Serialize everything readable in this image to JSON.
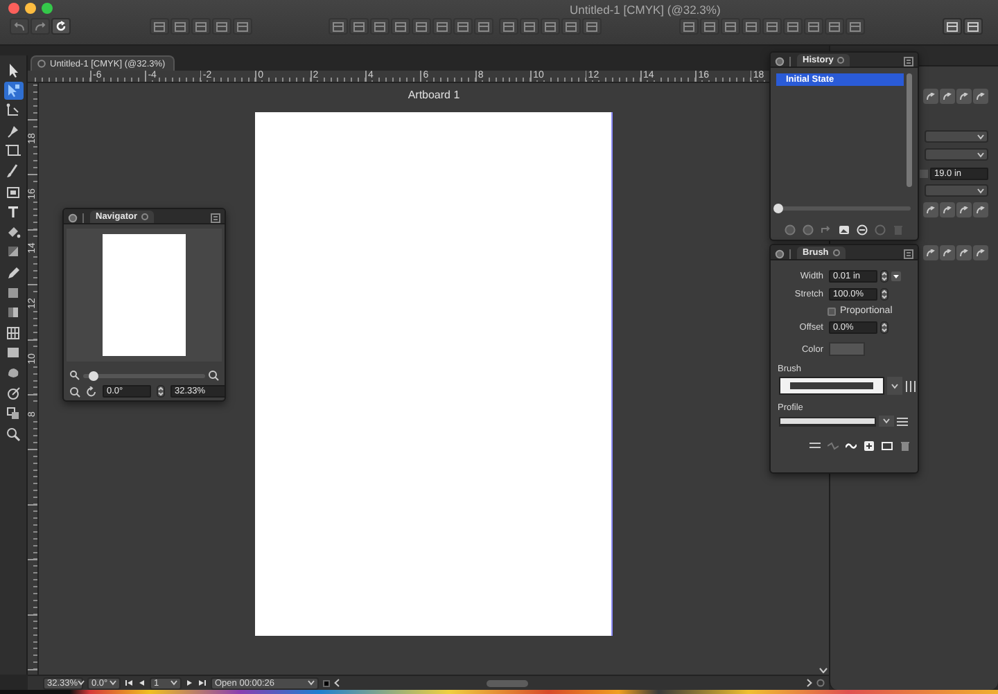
{
  "window": {
    "title": "Untitled-1 [CMYK] (@32.3%)"
  },
  "toolbar_groups": [
    [
      {
        "disabled": true
      },
      {
        "disabled": true
      },
      {
        "disabled": false
      }
    ],
    [
      {
        "disabled": true
      },
      {
        "disabled": true
      },
      {
        "disabled": true
      },
      {
        "disabled": true
      },
      {
        "disabled": true
      }
    ],
    [
      {
        "disabled": true
      },
      {
        "disabled": true
      },
      {
        "disabled": true
      },
      {
        "disabled": true
      },
      {
        "disabled": true
      },
      {
        "disabled": true
      },
      {
        "disabled": true
      },
      {
        "disabled": true
      }
    ],
    [
      {
        "disabled": true
      },
      {
        "disabled": true
      },
      {
        "disabled": true
      },
      {
        "disabled": true
      },
      {
        "disabled": true
      }
    ],
    [
      {
        "disabled": true
      },
      {
        "disabled": true
      },
      {
        "disabled": true
      },
      {
        "disabled": true
      },
      {
        "disabled": true
      },
      {
        "disabled": true
      },
      {
        "disabled": true
      },
      {
        "disabled": true
      },
      {
        "disabled": true
      }
    ],
    [
      {
        "disabled": false
      },
      {
        "disabled": false
      }
    ]
  ],
  "document_tab": {
    "title": "Untitled-1 [CMYK] (@32.3%)"
  },
  "ruler": {
    "horizontal": [
      "-6",
      "-4",
      "-2",
      "0",
      "2",
      "4",
      "6",
      "8",
      "10",
      "12",
      "14",
      "16",
      "18"
    ],
    "vertical": [
      "18",
      "16",
      "14",
      "12",
      "10",
      "8"
    ]
  },
  "tools": [
    {
      "selected": false
    },
    {
      "selected": true
    },
    {
      "selected": false
    },
    {
      "selected": false
    },
    {
      "selected": false
    },
    {
      "selected": false
    },
    {
      "selected": false
    },
    {
      "selected": false
    },
    {
      "selected": false
    },
    {
      "selected": false
    },
    {
      "selected": false
    },
    {
      "selected": false
    },
    {
      "selected": false
    },
    {
      "selected": false
    },
    {
      "selected": false
    },
    {
      "selected": false
    },
    {
      "selected": false
    },
    {
      "selected": false
    },
    {
      "selected": false
    }
  ],
  "artboard": {
    "label": "Artboard 1"
  },
  "navigator": {
    "title": "Navigator",
    "zoom_slider": {
      "level": 0.08
    },
    "rotation": "0.0°",
    "zoom": "32.33%"
  },
  "history": {
    "title": "History",
    "states": [
      {
        "label": "Initial State",
        "selected": true
      }
    ],
    "slider": {
      "level": 0
    }
  },
  "brush": {
    "title": "Brush",
    "width": {
      "label": "Width",
      "value": "0.01 in"
    },
    "stretch": {
      "label": "Stretch",
      "value": "100.0%"
    },
    "proportional": {
      "label": "Proportional",
      "checked": false
    },
    "offset": {
      "label": "Offset",
      "value": "0.0%"
    },
    "color": {
      "label": "Color"
    },
    "brush_label": "Brush",
    "profile_label": "Profile"
  },
  "dock": {
    "length": "19.0 in"
  },
  "status_bar": {
    "zoom": "32.33%",
    "rotation": "0.0°",
    "page": "1",
    "recording": "Open 00:00:26"
  }
}
